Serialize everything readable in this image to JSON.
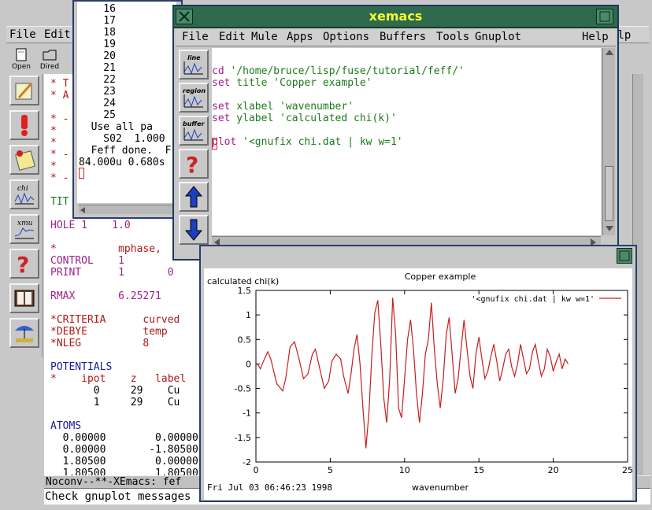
{
  "background_window": {
    "menu": [
      "File",
      "Edit"
    ],
    "help_label": "elp",
    "toolbar_top": [
      {
        "label": "Open",
        "icon": "open-file-icon"
      },
      {
        "label": "Dired",
        "icon": "dired-folder-icon"
      }
    ],
    "toolbar": [
      {
        "icon": "pencil-edit-icon"
      },
      {
        "icon": "exclamation-icon"
      },
      {
        "icon": "notepad-icon"
      },
      {
        "icon": "chi-plot-icon",
        "label": "chi"
      },
      {
        "icon": "xmu-plot-icon",
        "label": "xmu"
      },
      {
        "icon": "help-question-icon"
      },
      {
        "icon": "book-icon"
      },
      {
        "icon": "beach-icon"
      }
    ],
    "buffer_lines": [
      {
        "text": "* T",
        "color": "red"
      },
      {
        "text": "* A",
        "color": "red"
      },
      {
        "text": "",
        "color": "black"
      },
      {
        "text": "* -",
        "color": "red"
      },
      {
        "text": "*",
        "color": "red"
      },
      {
        "text": "*",
        "color": "red"
      },
      {
        "text": "* -",
        "color": "red"
      },
      {
        "text": "*",
        "color": "red"
      },
      {
        "text": "* -",
        "color": "red"
      },
      {
        "text": "",
        "color": "black"
      },
      {
        "text": "TIT",
        "color": "green"
      },
      {
        "text": "",
        "color": "black"
      },
      {
        "text": "HOLE 1    1.0",
        "color": "magenta"
      },
      {
        "text": "",
        "color": "black"
      },
      {
        "text": "*          mphase,",
        "color": "red"
      },
      {
        "text": "CONTROL    1",
        "color": "magenta"
      },
      {
        "text": "PRINT      1       0",
        "color": "magenta"
      },
      {
        "text": "",
        "color": "black"
      },
      {
        "text": "RMAX       6.25271",
        "color": "magenta"
      },
      {
        "text": "",
        "color": "black"
      },
      {
        "text": "*CRITERIA      curved",
        "color": "red"
      },
      {
        "text": "*DEBYE         temp",
        "color": "red"
      },
      {
        "text": "*NLEG          8",
        "color": "red"
      },
      {
        "text": "",
        "color": "black"
      },
      {
        "text": "POTENTIALS",
        "color": "blue"
      },
      {
        "text": "*    ipot    z   label",
        "color": "red"
      },
      {
        "text": "       0     29    Cu",
        "color": "black"
      },
      {
        "text": "       1     29    Cu",
        "color": "black"
      },
      {
        "text": "",
        "color": "black"
      },
      {
        "text": "ATOMS",
        "color": "blue"
      },
      {
        "text": "  0.00000        0.00000",
        "color": "black"
      },
      {
        "text": "  0.00000       -1.80500",
        "color": "black"
      },
      {
        "text": "  1.80500        0.00000",
        "color": "black"
      },
      {
        "text": "  1.80500        1.80500",
        "color": "black"
      }
    ],
    "modeline": "Noconv--**-XEmacs: fef",
    "minibuffer": "Check gnuplot messages"
  },
  "feff_window": {
    "lines": [
      "    16",
      "    17",
      "    18",
      "    19",
      "    20",
      "    21",
      "    22",
      "    23",
      "    24",
      "    25",
      "  Use all pa",
      "    S02  1.000",
      "  Feff done.  F",
      "84.000u 0.680s"
    ]
  },
  "xemacs_window": {
    "title": "xemacs",
    "menu": [
      "File",
      "Edit",
      "Mule",
      "Apps",
      "Options",
      "Buffers",
      "Tools",
      "Gnuplot",
      "Help"
    ],
    "toolbar": [
      {
        "icon": "line-plot-icon",
        "label": "line"
      },
      {
        "icon": "region-plot-icon",
        "label": "region"
      },
      {
        "icon": "buffer-plot-icon",
        "label": "buffer"
      },
      {
        "icon": "help-question-icon"
      },
      {
        "icon": "up-arrow-icon"
      },
      {
        "icon": "down-arrow-icon"
      }
    ],
    "code_lines": [
      {
        "keyword": "cd",
        "rest": " '/home/bruce/lisp/fuse/tutorial/feff/'"
      },
      {
        "keyword": "set",
        "rest": " title 'Copper example'"
      },
      {
        "keyword": "",
        "rest": ""
      },
      {
        "keyword": "set",
        "rest": " xlabel 'wavenumber'"
      },
      {
        "keyword": "set",
        "rest": " ylabel 'calculated chi(k)'"
      },
      {
        "keyword": "",
        "rest": ""
      },
      {
        "keyword": "plot",
        "rest": " '<gnufix chi.dat | kw w=1'"
      }
    ],
    "colors": {
      "keyword": "#a0208a",
      "string": "#1a7a1a",
      "title_bar": "#2f6a4e",
      "title_text": "#f4ff30"
    }
  },
  "gnuplot_window": {
    "timestamp": "Fri Jul 03 06:46:23 1998"
  },
  "chart_data": {
    "type": "line",
    "title": "Copper example",
    "xlabel": "wavenumber",
    "ylabel": "calculated chi(k)",
    "xlim": [
      0,
      25
    ],
    "ylim": [
      -2,
      1.5
    ],
    "xticks": [
      "0",
      "5",
      "10",
      "15",
      "20",
      "25"
    ],
    "yticks": [
      "1.5",
      "1",
      "0.5",
      "0",
      "-0.5",
      "-1",
      "-1.5",
      "-2"
    ],
    "legend_position": "top-right",
    "grid": false,
    "series": [
      {
        "name": "'<gnufix chi.dat | kw w=1'",
        "color": "#c81e1e",
        "x": [
          0.1,
          0.3,
          0.5,
          0.8,
          1.0,
          1.4,
          1.8,
          2.0,
          2.3,
          2.6,
          2.9,
          3.2,
          3.5,
          3.8,
          4.0,
          4.3,
          4.6,
          4.9,
          5.1,
          5.4,
          5.7,
          5.9,
          6.2,
          6.4,
          6.6,
          6.8,
          7.0,
          7.2,
          7.4,
          7.6,
          7.8,
          8.0,
          8.2,
          8.4,
          8.6,
          8.8,
          9.0,
          9.2,
          9.4,
          9.6,
          9.8,
          10.0,
          10.2,
          10.4,
          10.6,
          10.8,
          11.0,
          11.2,
          11.4,
          11.6,
          11.8,
          12.0,
          12.2,
          12.4,
          12.6,
          12.8,
          13.0,
          13.2,
          13.4,
          13.6,
          13.8,
          14.0,
          14.2,
          14.4,
          14.6,
          14.8,
          15.0,
          15.2,
          15.4,
          15.6,
          15.8,
          16.0,
          16.2,
          16.4,
          16.6,
          16.8,
          17.0,
          17.2,
          17.4,
          17.6,
          17.8,
          18.0,
          18.2,
          18.4,
          18.6,
          18.8,
          19.0,
          19.2,
          19.4,
          19.6,
          19.8,
          20.0,
          20.2,
          20.4,
          20.6,
          20.8,
          21.0
        ],
        "values": [
          0.0,
          -0.1,
          0.05,
          0.25,
          0.1,
          -0.4,
          -0.55,
          -0.3,
          0.35,
          0.45,
          0.1,
          -0.3,
          -0.2,
          0.2,
          0.3,
          -0.1,
          -0.5,
          -0.35,
          0.05,
          0.2,
          0.1,
          -0.25,
          -0.6,
          -0.2,
          0.3,
          0.6,
          0.0,
          -0.9,
          -1.72,
          -1.0,
          0.2,
          1.05,
          1.3,
          0.4,
          -0.7,
          -1.2,
          -0.3,
          1.35,
          0.6,
          -0.9,
          -1.1,
          -0.3,
          0.5,
          0.9,
          0.3,
          -0.6,
          -1.2,
          -0.6,
          0.2,
          0.5,
          1.25,
          0.3,
          -0.4,
          -0.9,
          -0.3,
          0.6,
          0.95,
          0.2,
          -0.6,
          -0.3,
          0.3,
          0.9,
          0.3,
          -0.25,
          -0.5,
          0.2,
          0.55,
          0.1,
          -0.3,
          -0.15,
          0.15,
          0.4,
          0.05,
          -0.35,
          -0.1,
          0.2,
          0.3,
          -0.05,
          -0.25,
          0.0,
          0.4,
          0.1,
          -0.2,
          -0.1,
          0.25,
          0.4,
          0.05,
          -0.25,
          -0.1,
          0.3,
          0.15,
          -0.15,
          0.05,
          0.2,
          -0.1,
          0.1,
          0.0
        ]
      }
    ]
  }
}
